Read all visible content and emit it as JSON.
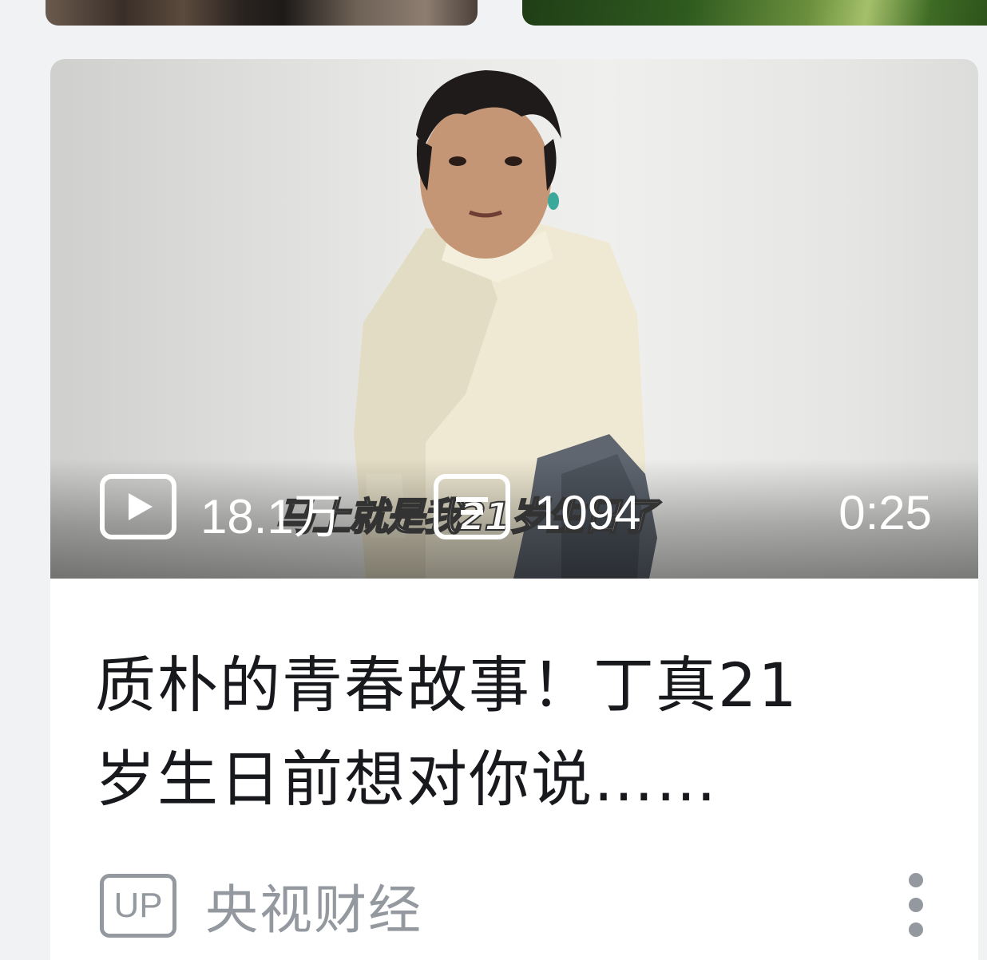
{
  "video": {
    "views": "18.1万",
    "danmaku": "1094",
    "duration": "0:25",
    "subtitle": "马上就是我21岁生日了",
    "title_line1": "质朴的青春故事！丁真21",
    "title_line2": "岁生日前想对你说……",
    "author_badge": "UP",
    "author": "央视财经"
  },
  "icons": {
    "views": "play-count-icon",
    "danmaku": "danmaku-icon",
    "more": "more-vertical-icon"
  }
}
